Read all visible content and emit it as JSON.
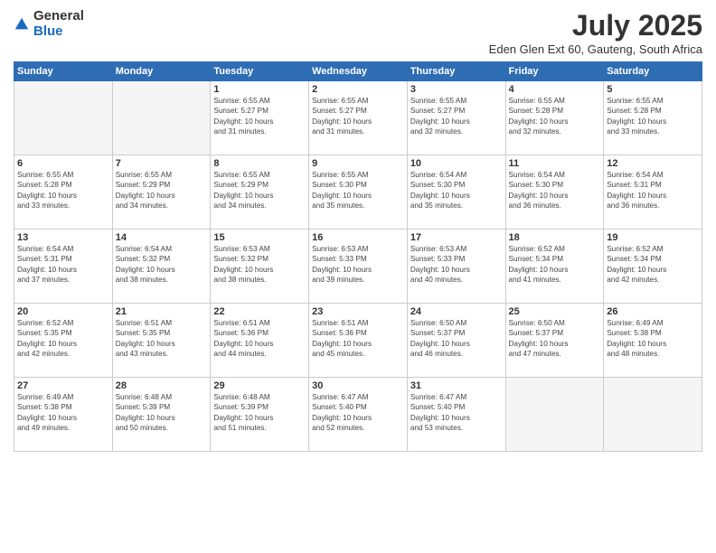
{
  "logo": {
    "general": "General",
    "blue": "Blue"
  },
  "title": "July 2025",
  "location": "Eden Glen Ext 60, Gauteng, South Africa",
  "days_header": [
    "Sunday",
    "Monday",
    "Tuesday",
    "Wednesday",
    "Thursday",
    "Friday",
    "Saturday"
  ],
  "weeks": [
    [
      {
        "day": "",
        "info": ""
      },
      {
        "day": "",
        "info": ""
      },
      {
        "day": "1",
        "info": "Sunrise: 6:55 AM\nSunset: 5:27 PM\nDaylight: 10 hours\nand 31 minutes."
      },
      {
        "day": "2",
        "info": "Sunrise: 6:55 AM\nSunset: 5:27 PM\nDaylight: 10 hours\nand 31 minutes."
      },
      {
        "day": "3",
        "info": "Sunrise: 6:55 AM\nSunset: 5:27 PM\nDaylight: 10 hours\nand 32 minutes."
      },
      {
        "day": "4",
        "info": "Sunrise: 6:55 AM\nSunset: 5:28 PM\nDaylight: 10 hours\nand 32 minutes."
      },
      {
        "day": "5",
        "info": "Sunrise: 6:55 AM\nSunset: 5:28 PM\nDaylight: 10 hours\nand 33 minutes."
      }
    ],
    [
      {
        "day": "6",
        "info": "Sunrise: 6:55 AM\nSunset: 5:28 PM\nDaylight: 10 hours\nand 33 minutes."
      },
      {
        "day": "7",
        "info": "Sunrise: 6:55 AM\nSunset: 5:29 PM\nDaylight: 10 hours\nand 34 minutes."
      },
      {
        "day": "8",
        "info": "Sunrise: 6:55 AM\nSunset: 5:29 PM\nDaylight: 10 hours\nand 34 minutes."
      },
      {
        "day": "9",
        "info": "Sunrise: 6:55 AM\nSunset: 5:30 PM\nDaylight: 10 hours\nand 35 minutes."
      },
      {
        "day": "10",
        "info": "Sunrise: 6:54 AM\nSunset: 5:30 PM\nDaylight: 10 hours\nand 35 minutes."
      },
      {
        "day": "11",
        "info": "Sunrise: 6:54 AM\nSunset: 5:30 PM\nDaylight: 10 hours\nand 36 minutes."
      },
      {
        "day": "12",
        "info": "Sunrise: 6:54 AM\nSunset: 5:31 PM\nDaylight: 10 hours\nand 36 minutes."
      }
    ],
    [
      {
        "day": "13",
        "info": "Sunrise: 6:54 AM\nSunset: 5:31 PM\nDaylight: 10 hours\nand 37 minutes."
      },
      {
        "day": "14",
        "info": "Sunrise: 6:54 AM\nSunset: 5:32 PM\nDaylight: 10 hours\nand 38 minutes."
      },
      {
        "day": "15",
        "info": "Sunrise: 6:53 AM\nSunset: 5:32 PM\nDaylight: 10 hours\nand 38 minutes."
      },
      {
        "day": "16",
        "info": "Sunrise: 6:53 AM\nSunset: 5:33 PM\nDaylight: 10 hours\nand 39 minutes."
      },
      {
        "day": "17",
        "info": "Sunrise: 6:53 AM\nSunset: 5:33 PM\nDaylight: 10 hours\nand 40 minutes."
      },
      {
        "day": "18",
        "info": "Sunrise: 6:52 AM\nSunset: 5:34 PM\nDaylight: 10 hours\nand 41 minutes."
      },
      {
        "day": "19",
        "info": "Sunrise: 6:52 AM\nSunset: 5:34 PM\nDaylight: 10 hours\nand 42 minutes."
      }
    ],
    [
      {
        "day": "20",
        "info": "Sunrise: 6:52 AM\nSunset: 5:35 PM\nDaylight: 10 hours\nand 42 minutes."
      },
      {
        "day": "21",
        "info": "Sunrise: 6:51 AM\nSunset: 5:35 PM\nDaylight: 10 hours\nand 43 minutes."
      },
      {
        "day": "22",
        "info": "Sunrise: 6:51 AM\nSunset: 5:36 PM\nDaylight: 10 hours\nand 44 minutes."
      },
      {
        "day": "23",
        "info": "Sunrise: 6:51 AM\nSunset: 5:36 PM\nDaylight: 10 hours\nand 45 minutes."
      },
      {
        "day": "24",
        "info": "Sunrise: 6:50 AM\nSunset: 5:37 PM\nDaylight: 10 hours\nand 46 minutes."
      },
      {
        "day": "25",
        "info": "Sunrise: 6:50 AM\nSunset: 5:37 PM\nDaylight: 10 hours\nand 47 minutes."
      },
      {
        "day": "26",
        "info": "Sunrise: 6:49 AM\nSunset: 5:38 PM\nDaylight: 10 hours\nand 48 minutes."
      }
    ],
    [
      {
        "day": "27",
        "info": "Sunrise: 6:49 AM\nSunset: 5:38 PM\nDaylight: 10 hours\nand 49 minutes."
      },
      {
        "day": "28",
        "info": "Sunrise: 6:48 AM\nSunset: 5:39 PM\nDaylight: 10 hours\nand 50 minutes."
      },
      {
        "day": "29",
        "info": "Sunrise: 6:48 AM\nSunset: 5:39 PM\nDaylight: 10 hours\nand 51 minutes."
      },
      {
        "day": "30",
        "info": "Sunrise: 6:47 AM\nSunset: 5:40 PM\nDaylight: 10 hours\nand 52 minutes."
      },
      {
        "day": "31",
        "info": "Sunrise: 6:47 AM\nSunset: 5:40 PM\nDaylight: 10 hours\nand 53 minutes."
      },
      {
        "day": "",
        "info": ""
      },
      {
        "day": "",
        "info": ""
      }
    ]
  ]
}
